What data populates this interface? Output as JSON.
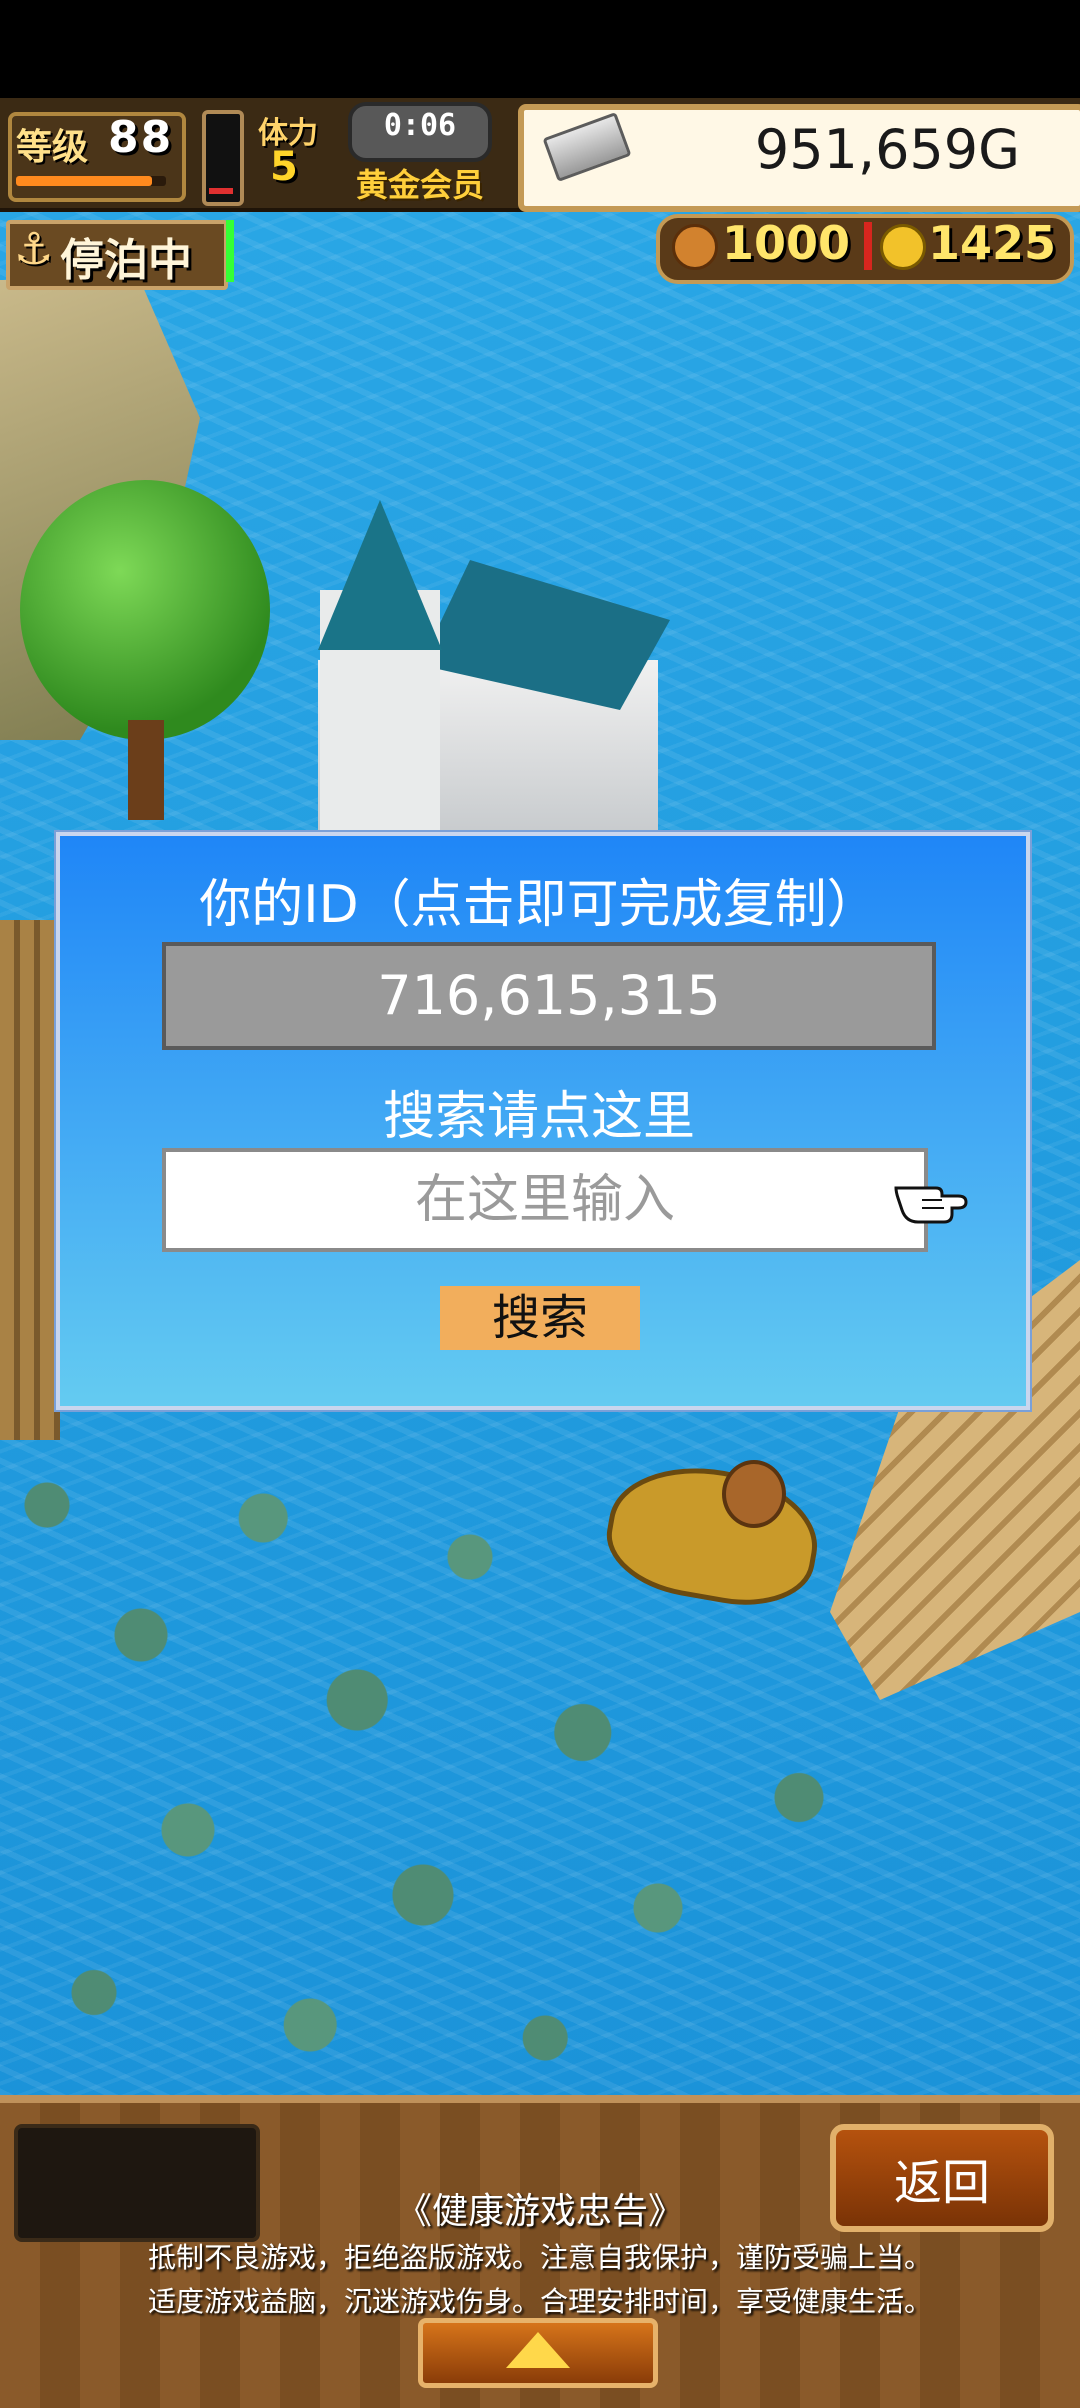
{
  "hud": {
    "level_label": "等级",
    "level_value": "88",
    "level_progress": 0.9,
    "stamina_label": "体力",
    "stamina_value": "5",
    "stamina_fill": 0.08,
    "timer": "0:06",
    "membership": "黄金会员",
    "money": "951,659G",
    "money_icon": "silver-bar-icon",
    "dock_status": "停泊中",
    "dock_icon": "anchor-icon",
    "resource1_value": "1000",
    "resource1_icon": "coin-orange-icon",
    "resource2_value": "1425",
    "resource2_icon": "coin-gold-icon"
  },
  "dialog": {
    "id_title": "你的ID（点击即可完成复制）",
    "id_value": "716,615,315",
    "search_label": "搜索请点这里",
    "search_placeholder": "在这里输入",
    "search_value": "",
    "search_button": "搜索",
    "pointer_icon": "pointing-hand-icon"
  },
  "bottom": {
    "back_button": "返回",
    "warning_title": "《健康游戏忠告》",
    "warning_line1": "抵制不良游戏，拒绝盗版游戏。注意自我保护，谨防受骗上当。",
    "warning_line2": "适度游戏益脑，沉迷游戏伤身。合理安排时间，享受健康生活。",
    "expand_icon": "up-arrow-icon"
  },
  "colors": {
    "dialog_top": "#1f86f7",
    "dialog_bottom": "#64cbf1",
    "search_button": "#f2ae5c",
    "sea": "#2aa7e6",
    "hud_frame": "#c49a55"
  }
}
